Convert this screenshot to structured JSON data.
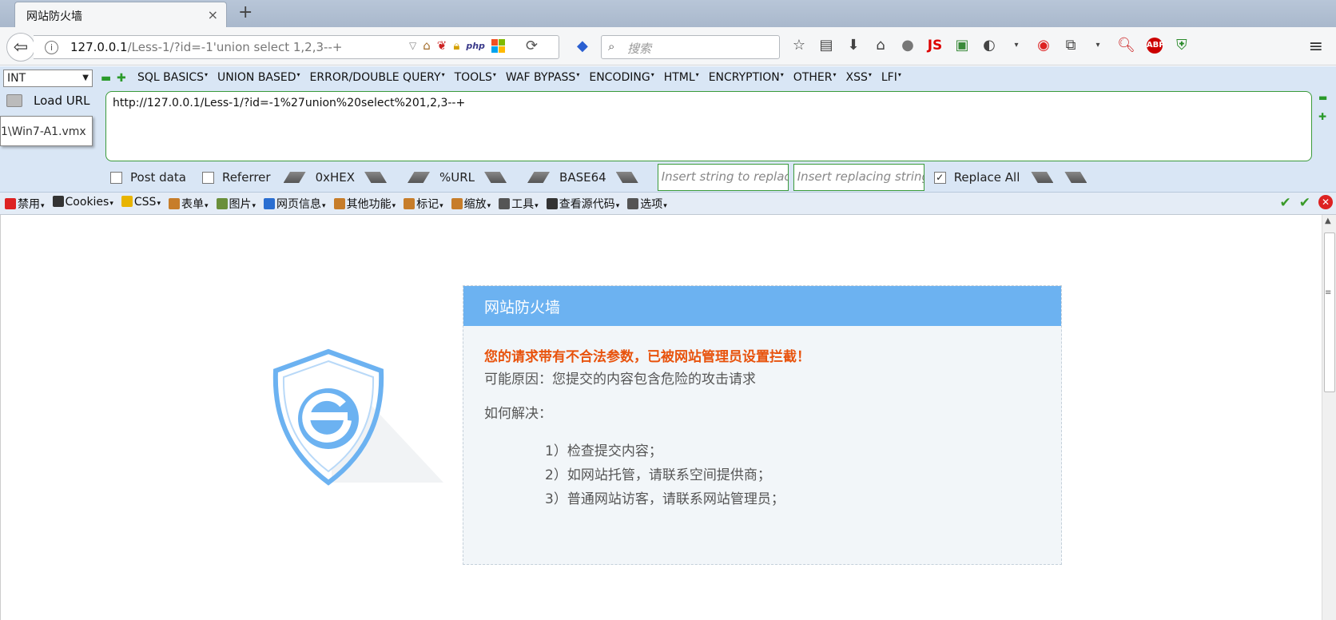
{
  "tab": {
    "title": "网站防火墙"
  },
  "navbar": {
    "url_host": "127.0.0.1",
    "url_path": "/Less-1/?id=-1'union select 1,2,3--+",
    "php_badge": "php",
    "search_placeholder": "搜索",
    "js_label": "JS",
    "abp_label": "ABP"
  },
  "hackbar": {
    "type_select": "INT",
    "menus": [
      "SQL BASICS",
      "UNION BASED",
      "ERROR/DOUBLE QUERY",
      "TOOLS",
      "WAF BYPASS",
      "ENCODING",
      "HTML",
      "ENCRYPTION",
      "OTHER",
      "XSS",
      "LFI"
    ],
    "load_url": "Load URL",
    "tooltip": "1\\Win7-A1.vmx",
    "url_value": "http://127.0.0.1/Less-1/?id=-1%27union%20select%201,2,3--+",
    "post_data": "Post data",
    "referrer": "Referrer",
    "hex": "0xHEX",
    "urlenc": "%URL",
    "base64": "BASE64",
    "insert_placeholder": "Insert string to replac",
    "replacing_placeholder": "Insert replacing string",
    "replace_all": "Replace All",
    "replace_all_checked": true
  },
  "webdev": {
    "items": [
      {
        "label": "禁用",
        "icon_color": "#d22"
      },
      {
        "label": "Cookies",
        "icon_color": "#333"
      },
      {
        "label": "CSS",
        "icon_color": "#e8b400"
      },
      {
        "label": "表单",
        "icon_color": "#c77d2a"
      },
      {
        "label": "图片",
        "icon_color": "#6a8f3a"
      },
      {
        "label": "网页信息",
        "icon_color": "#2a6ed1"
      },
      {
        "label": "其他功能",
        "icon_color": "#c77d2a"
      },
      {
        "label": "标记",
        "icon_color": "#c77d2a"
      },
      {
        "label": "缩放",
        "icon_color": "#c77d2a"
      },
      {
        "label": "工具",
        "icon_color": "#555"
      },
      {
        "label": "查看源代码",
        "icon_color": "#333"
      },
      {
        "label": "选项",
        "icon_color": "#555"
      }
    ]
  },
  "page": {
    "card_title": "网站防火墙",
    "warning": "您的请求带有不合法参数，已被网站管理员设置拦截！",
    "reason": "可能原因：您提交的内容包含危险的攻击请求",
    "how_title": "如何解决：",
    "steps": [
      "1）检查提交内容；",
      "2）如网站托管，请联系空间提供商；",
      "3）普通网站访客，请联系网站管理员；"
    ]
  },
  "colors": {
    "card_header": "#6cb2f1",
    "warning_text": "#e8530d",
    "card_bg": "#f2f6f9",
    "shield": "#6cb2f1",
    "hackbar_bg": "#d9e6f5"
  }
}
